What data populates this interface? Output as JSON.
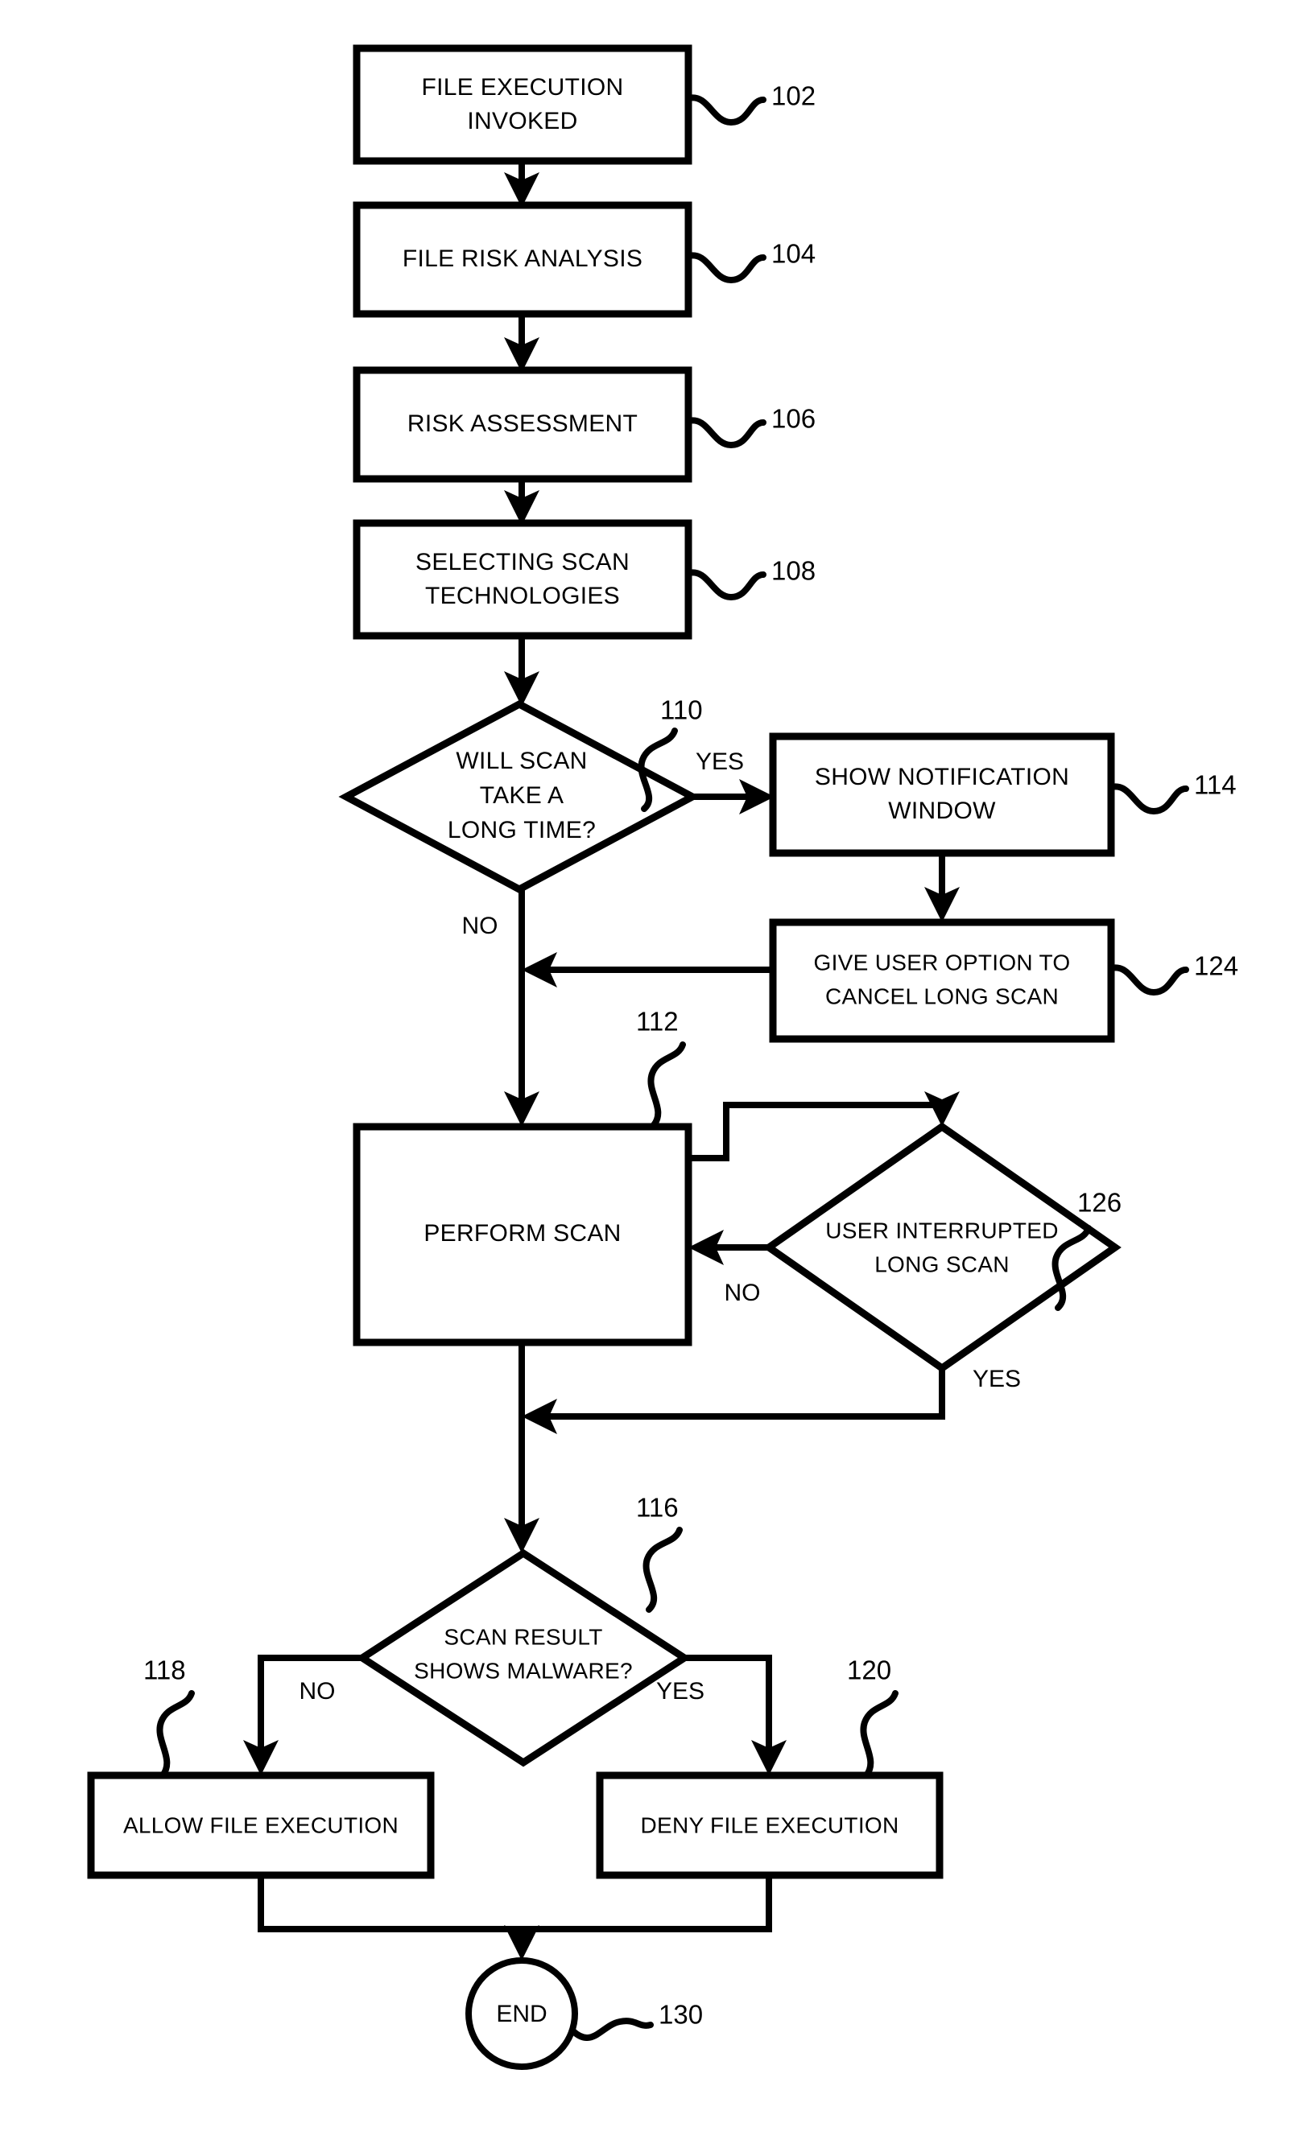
{
  "diagram": {
    "type": "flowchart",
    "title": "File execution malware scanning flowchart",
    "orientation": "top-to-bottom",
    "line_color": "#000000",
    "fill_color": "#ffffff",
    "background": "#ffffff"
  },
  "nodes": {
    "n102": {
      "ref": "102",
      "shape": "process",
      "line1": "FILE EXECUTION",
      "line2": "INVOKED"
    },
    "n104": {
      "ref": "104",
      "shape": "process",
      "line1": "FILE RISK ANALYSIS",
      "line2": ""
    },
    "n106": {
      "ref": "106",
      "shape": "process",
      "line1": "RISK ASSESSMENT",
      "line2": ""
    },
    "n108": {
      "ref": "108",
      "shape": "process",
      "line1": "SELECTING SCAN",
      "line2": "TECHNOLOGIES"
    },
    "n110": {
      "ref": "110",
      "shape": "decision",
      "line1": "WILL SCAN",
      "line2": "TAKE A",
      "line3": "LONG TIME?"
    },
    "n114": {
      "ref": "114",
      "shape": "process",
      "line1": "SHOW NOTIFICATION",
      "line2": "WINDOW"
    },
    "n124": {
      "ref": "124",
      "shape": "process",
      "line1": "GIVE USER OPTION TO",
      "line2": "CANCEL LONG SCAN"
    },
    "n112": {
      "ref": "112",
      "shape": "process",
      "line1": "PERFORM SCAN",
      "line2": ""
    },
    "n126": {
      "ref": "126",
      "shape": "decision",
      "line1": "USER INTERRUPTED",
      "line2": "LONG SCAN"
    },
    "n116": {
      "ref": "116",
      "shape": "decision",
      "line1": "SCAN RESULT",
      "line2": "SHOWS MALWARE?"
    },
    "n118": {
      "ref": "118",
      "shape": "process",
      "line1": "ALLOW FILE EXECUTION",
      "line2": ""
    },
    "n120": {
      "ref": "120",
      "shape": "process",
      "line1": "DENY FILE EXECUTION",
      "line2": ""
    },
    "n130": {
      "ref": "130",
      "shape": "terminator",
      "line1": "END",
      "line2": ""
    }
  },
  "branch_labels": {
    "d110_yes": "YES",
    "d110_no": "NO",
    "d126_no": "NO",
    "d126_yes": "YES",
    "d116_no": "NO",
    "d116_yes": "YES"
  },
  "edges": [
    {
      "from": "102",
      "to": "104",
      "label": ""
    },
    {
      "from": "104",
      "to": "106",
      "label": ""
    },
    {
      "from": "106",
      "to": "108",
      "label": ""
    },
    {
      "from": "108",
      "to": "110",
      "label": ""
    },
    {
      "from": "110",
      "to": "114",
      "label": "YES"
    },
    {
      "from": "110",
      "to": "112",
      "label": "NO"
    },
    {
      "from": "114",
      "to": "124",
      "label": ""
    },
    {
      "from": "124",
      "to": "112",
      "label": ""
    },
    {
      "from": "112",
      "to": "126",
      "label": ""
    },
    {
      "from": "126",
      "to": "112",
      "label": "NO"
    },
    {
      "from": "126",
      "to": "116",
      "label": "YES"
    },
    {
      "from": "112",
      "to": "116",
      "label": ""
    },
    {
      "from": "116",
      "to": "118",
      "label": "NO"
    },
    {
      "from": "116",
      "to": "120",
      "label": "YES"
    },
    {
      "from": "118",
      "to": "130",
      "label": ""
    },
    {
      "from": "120",
      "to": "130",
      "label": ""
    }
  ]
}
